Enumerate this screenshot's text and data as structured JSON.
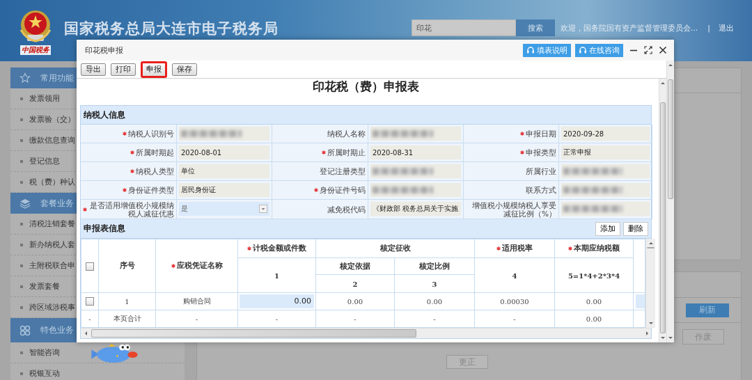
{
  "header": {
    "logo_text": "中国税务",
    "title": "国家税务总局大连市电子税务局",
    "search": {
      "value": "印花"
    },
    "search_button": "搜索",
    "welcome": "欢迎，国务院国有资产监督管理委员会...",
    "separator": "|",
    "logout": "退出"
  },
  "sidebar": {
    "sections": [
      {
        "title": "常用功能",
        "items": [
          "发票领用",
          "发票验（交）",
          "缴款信息查询",
          "登记信息",
          "税（费）种认"
        ]
      },
      {
        "title": "套餐业务",
        "items": [
          "清税注销套餐",
          "新办纳税人套",
          "主附税联合申",
          "发票套餐",
          "跨区域涉税事"
        ]
      },
      {
        "title": "特色业务",
        "items": [
          "智能咨询",
          "税银互动"
        ]
      }
    ]
  },
  "main": {
    "refresh_button": "刷新",
    "void_button": "作废",
    "correct_button": "更正"
  },
  "dialog": {
    "title": "印花税申报",
    "help_buttons": [
      "填表说明",
      "在线咨询"
    ],
    "toolbar": [
      {
        "label": "导出",
        "highlighted": false
      },
      {
        "label": "打印",
        "highlighted": false
      },
      {
        "label": "申报",
        "highlighted": true
      },
      {
        "label": "保存",
        "highlighted": false
      }
    ],
    "form_title": "印花税（费）申报表",
    "taxpayer_section": {
      "title": "纳税人信息",
      "fields": [
        {
          "label": "纳税人识别号",
          "required": true,
          "kind": "text"
        },
        {
          "label": "纳税人名称",
          "required": false,
          "kind": "text"
        },
        {
          "label": "申报日期",
          "required": true,
          "kind": "text",
          "value": "2020-09-28"
        },
        {
          "label": "所属时期起",
          "required": true,
          "kind": "text",
          "value": "2020-08-01"
        },
        {
          "label": "所属时期止",
          "required": true,
          "kind": "text",
          "value": "2020-08-31"
        },
        {
          "label": "申报类型",
          "required": true,
          "kind": "text",
          "value": "正常申报"
        },
        {
          "label": "纳税人类型",
          "required": true,
          "kind": "text",
          "value": "单位"
        },
        {
          "label": "登记注册类型",
          "required": false,
          "kind": "text"
        },
        {
          "label": "所属行业",
          "required": false,
          "kind": "text"
        },
        {
          "label": "身份证件类型",
          "required": true,
          "kind": "text",
          "value": "居民身份证"
        },
        {
          "label": "身份证件号码",
          "required": true,
          "kind": "text"
        },
        {
          "label": "联系方式",
          "required": false,
          "kind": "text"
        },
        {
          "label": "是否适用增值税小规模纳税人减征优惠",
          "required": true,
          "kind": "select",
          "value": "是"
        },
        {
          "label": "减免税代码",
          "required": false,
          "kind": "text",
          "value": "《财政部 税务总局关于实施"
        },
        {
          "label": "增值税小规模纳税人享受减征比例（%）",
          "required": false,
          "kind": "text"
        }
      ]
    },
    "declaration_section": {
      "title": "申报表信息",
      "buttons": [
        "添加",
        "删除"
      ],
      "select_all_checked": false,
      "columns": [
        {
          "label": "序号",
          "required": false,
          "editable": false
        },
        {
          "label": "应税凭证名称",
          "required": true,
          "editable": false
        },
        {
          "label": "计税金额或件数",
          "required": true,
          "number": "1",
          "editable": true
        },
        {
          "group": "核定征收",
          "colspan": 2,
          "children": [
            {
              "label": "核定依据",
              "required": false,
              "number": "2",
              "editable": false
            },
            {
              "label": "核定比例",
              "required": false,
              "number": "3",
              "editable": false
            }
          ]
        },
        {
          "label": "适用税率",
          "required": true,
          "number": "4",
          "editable": false
        },
        {
          "label": "本期应纳税额",
          "required": true,
          "number": "5=1*4+2*3*4",
          "editable": false
        }
      ],
      "rows": [
        {
          "kind": "data",
          "checked": false,
          "cells": [
            "1",
            "购销合同",
            "0.00",
            "0.00",
            "0.00",
            "0.00030",
            "0.00"
          ]
        },
        {
          "kind": "total",
          "marker": "-",
          "cells": [
            "本页合计",
            "-",
            "-",
            "-",
            "-",
            "-",
            "0.00"
          ]
        }
      ]
    }
  }
}
